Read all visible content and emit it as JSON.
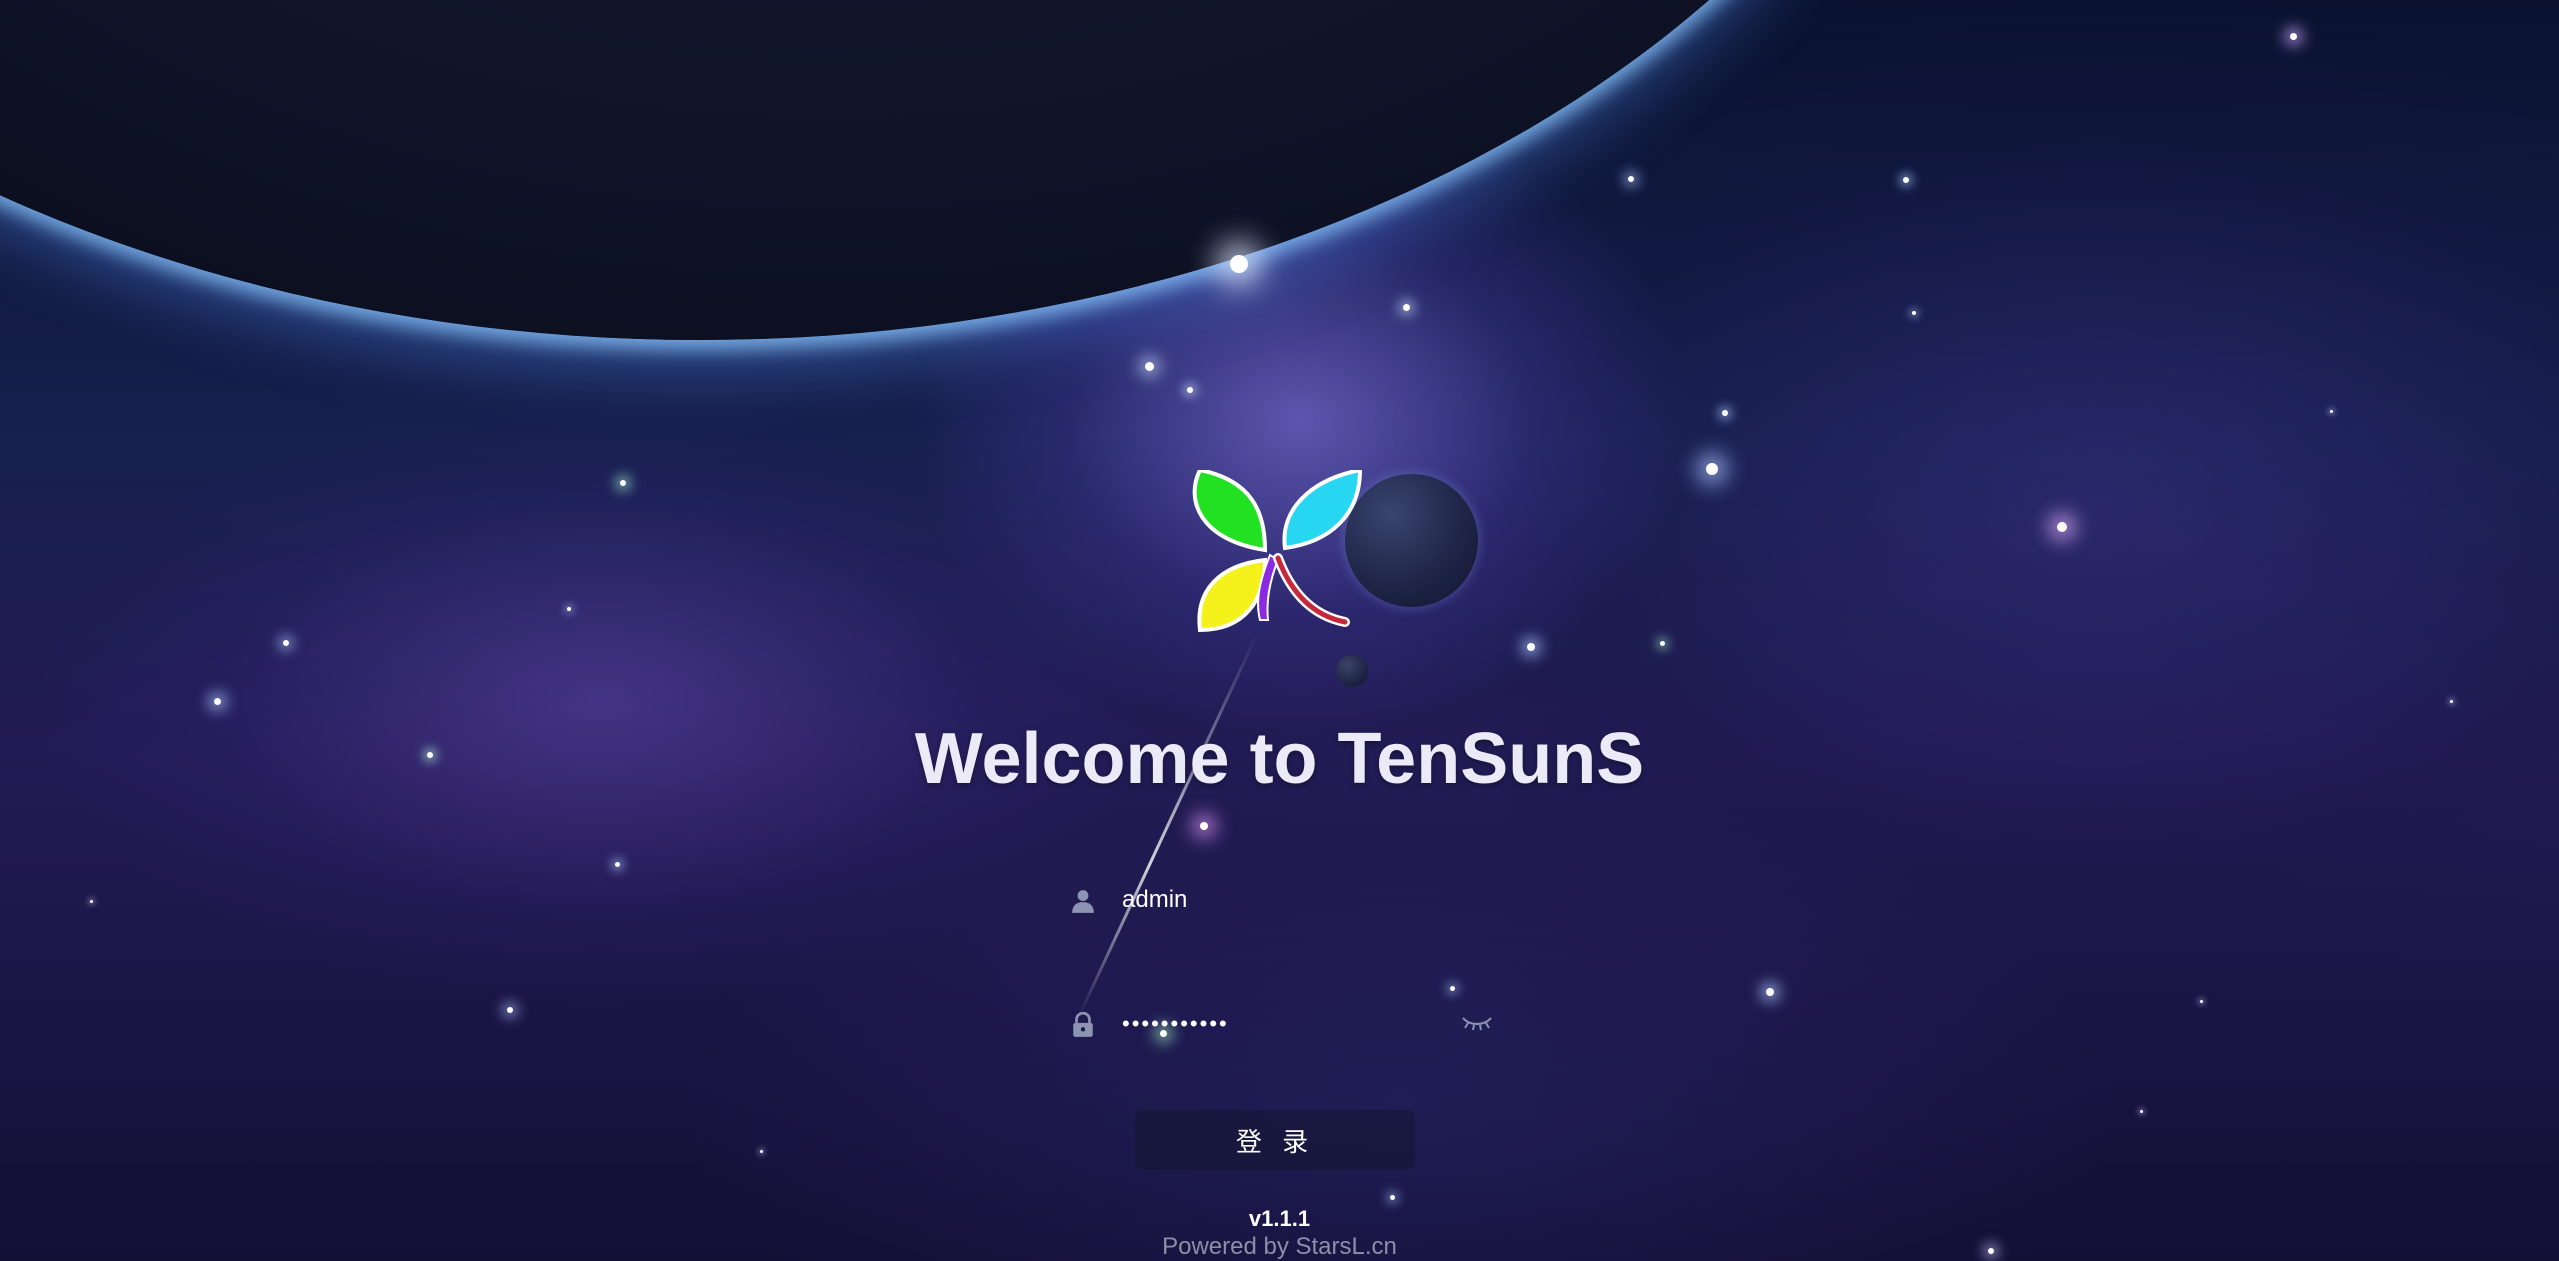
{
  "page": {
    "title": "Welcome to TenSunS"
  },
  "login": {
    "username_value": "admin",
    "password_value": "•••••••••••",
    "button_label": "登 录"
  },
  "footer": {
    "version": "v1.1.1",
    "powered_by": "Powered by StarsL.cn"
  },
  "icons": {
    "username": "user-icon",
    "password": "lock-icon",
    "toggle_password": "eye-closed-icon",
    "logo": "four-leaf-logo"
  },
  "colors": {
    "title_text": "#eceaf6",
    "leaf_green": "#22e022",
    "leaf_cyan": "#27d6f0",
    "leaf_yellow": "#f4f21a",
    "leaf_purple": "#8a2be2",
    "stem_red": "#c8283c"
  }
}
